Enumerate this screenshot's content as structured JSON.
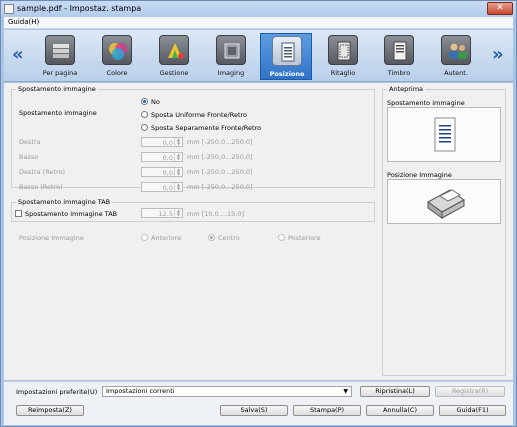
{
  "window": {
    "title": "sample.pdf - Impostaz. stampa",
    "close_glyph": "✕"
  },
  "menubar": {
    "guida_label": "Guida(H)"
  },
  "ribbon": {
    "left_arrow": "«",
    "right_arrow": "»",
    "items": [
      {
        "label": "Per pagina",
        "icon": "pages-stack-icon"
      },
      {
        "label": "Colore",
        "icon": "color-circles-icon"
      },
      {
        "label": "Gestione",
        "icon": "color-management-icon"
      },
      {
        "label": "Imaging",
        "icon": "imaging-icon"
      },
      {
        "label": "Posizione",
        "icon": "position-icon"
      },
      {
        "label": "Ritaglio",
        "icon": "trim-icon"
      },
      {
        "label": "Timbro",
        "icon": "stamp-icon"
      },
      {
        "label": "Autent.",
        "icon": "authentication-icon"
      }
    ],
    "active_index": 4
  },
  "image_shift": {
    "group_title": "Spostamento immagine",
    "row_label": "Spostamento immagine",
    "options": [
      "No",
      "Sposta Uniforme Fronte/Retro",
      "Sposta Separamente Fronte/Retro"
    ],
    "selected": "No",
    "fields": [
      {
        "label": "Destra",
        "value": "0,0",
        "range": "mm [-250,0...250,0]"
      },
      {
        "label": "Basso",
        "value": "0,0",
        "range": "mm [-250,0...250,0]"
      },
      {
        "label": "Destra (Retro)",
        "value": "0,0",
        "range": "mm [-250,0...250,0]"
      },
      {
        "label": "Basso (Retro)",
        "value": "0,0",
        "range": "mm [-250,0...250,0]"
      }
    ]
  },
  "tab_shift": {
    "group_title": "Spostamento immagine TAB",
    "checkbox_label": "Spostamento immagine TAB",
    "value": "12,5",
    "range": "mm [10,0....15,0]"
  },
  "image_position": {
    "label": "Posizione Immagine",
    "options": [
      "Anteriore",
      "Centro",
      "Posteriore"
    ],
    "selected": "Centro"
  },
  "preview": {
    "group_title": "Anteprima",
    "shift_label": "Spostamento immagine",
    "position_label": "Posizione Immagine"
  },
  "bottom": {
    "favorites_label": "Impostazioni preferite(U)",
    "favorites_value": "Impostazioni correnti",
    "ripristina": "Ripristina(L)",
    "registra": "Registra(R)",
    "reimposta": "Reimposta(Z)",
    "salva": "Salva(S)",
    "stampa": "Stampa(P)",
    "annulla": "Annulla(C)",
    "guida": "Guida(F1)"
  },
  "colors": {
    "accent": "#2f74c8",
    "ribbon_bg": "#c9dbf0"
  }
}
